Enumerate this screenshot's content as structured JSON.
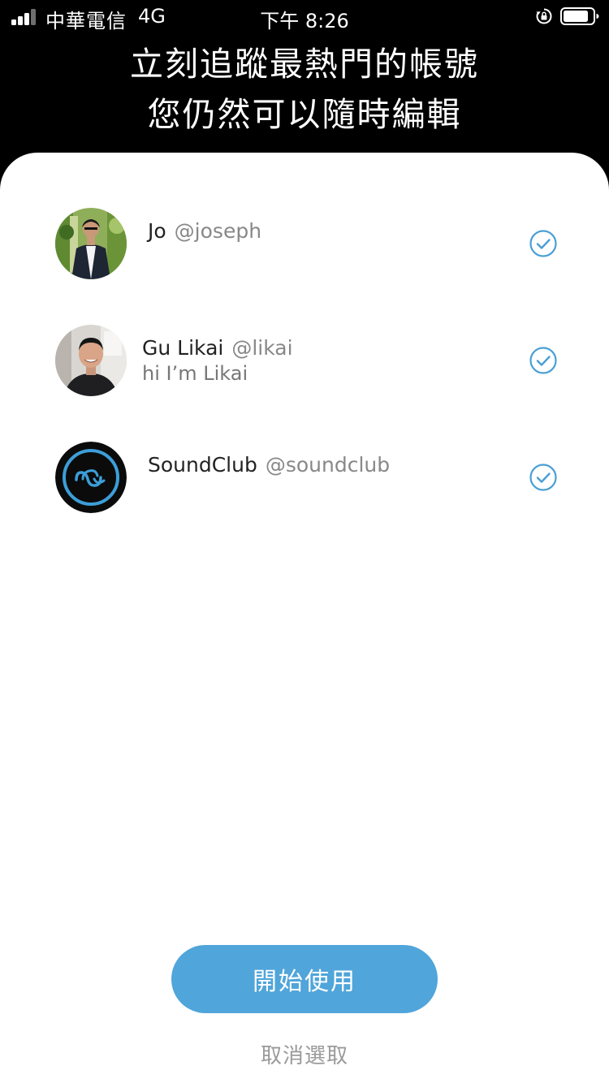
{
  "status_bar": {
    "carrier": "中華電信",
    "network": "4G",
    "time": "下午 8:26",
    "icons": [
      "signal-icon",
      "rotation-lock-icon",
      "battery-icon"
    ]
  },
  "header": {
    "title_line1": "立刻追蹤最熱門的帳號",
    "title_line2": "您仍然可以隨時編輯"
  },
  "accounts": [
    {
      "name": "Jo",
      "handle": "@joseph",
      "bio": "",
      "selected": true,
      "avatar": "photo-man-in-suit"
    },
    {
      "name": "Gu Likai",
      "handle": "@likai",
      "bio": "hi I’m Likai",
      "selected": true,
      "avatar": "photo-smiling-man"
    },
    {
      "name": "SoundClub",
      "handle": "@soundclub",
      "bio": "",
      "selected": true,
      "avatar": "soundclub-logo"
    }
  ],
  "actions": {
    "start_label": "開始使用",
    "deselect_label": "取消選取"
  },
  "colors": {
    "accent": "#50a5da",
    "check": "#4a9fd5",
    "header_bg": "#000000",
    "sheet_bg": "#ffffff"
  }
}
